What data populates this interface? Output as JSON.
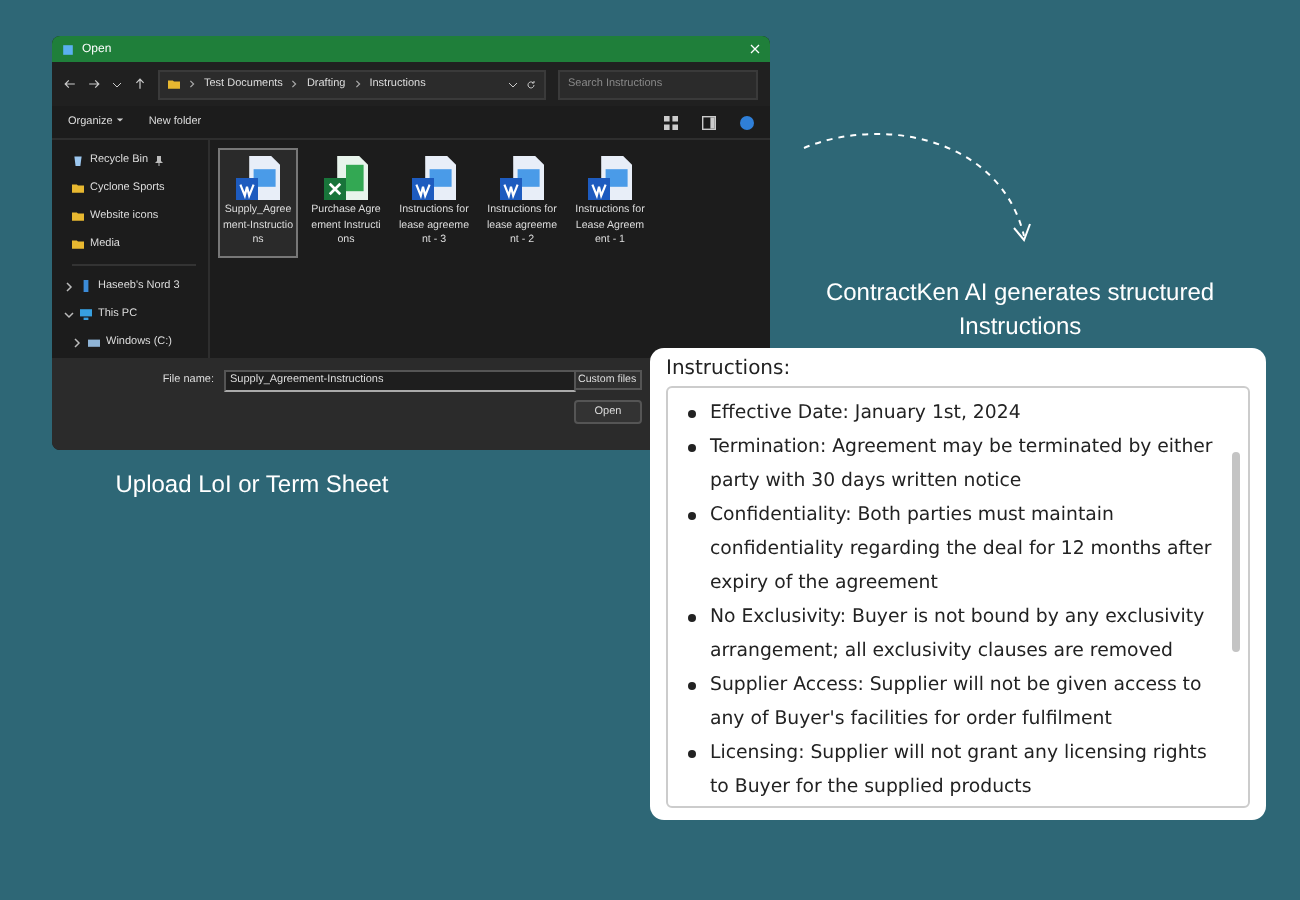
{
  "dialog": {
    "title": "Open",
    "breadcrumb": [
      "Test Documents",
      "Drafting",
      "Instructions"
    ],
    "search": {
      "placeholder": "Search Instructions"
    },
    "toolbar": [
      {
        "label": "Organize",
        "dropdown": true
      },
      {
        "label": "New folder",
        "dropdown": false
      }
    ],
    "sidebar": {
      "items": [
        {
          "label": "Recycle Bin",
          "kind": "bin",
          "pinned": true
        },
        {
          "label": "Cyclone Sports",
          "kind": "folder",
          "pinned": false
        },
        {
          "label": "Website icons",
          "kind": "folder",
          "pinned": false
        },
        {
          "label": "Media",
          "kind": "folder",
          "pinned": false
        },
        {
          "label": "Haseeb's Nord 3",
          "kind": "phone",
          "expanded": false
        },
        {
          "label": "This PC",
          "kind": "pc",
          "expanded": true,
          "children": [
            {
              "label": "Windows (C:)",
              "kind": "drive",
              "expanded": false
            }
          ]
        }
      ]
    },
    "files": [
      {
        "name": "Supply_Agreement-Instructions",
        "kind": "word",
        "selected": true
      },
      {
        "name": "Purchase Agreement Instructions",
        "kind": "excel",
        "selected": false
      },
      {
        "name": "Instructions for lease agreement - 3",
        "kind": "word",
        "selected": false
      },
      {
        "name": "Instructions for lease agreement - 2",
        "kind": "word",
        "selected": false
      },
      {
        "name": "Instructions for Lease Agreement - 1",
        "kind": "word",
        "selected": false
      }
    ],
    "file_name_label": "File name:",
    "file_name_value": "Supply_Agreement-Instructions",
    "file_type": "Custom files",
    "open_button": "Open"
  },
  "upload_caption": "Upload LoI or Term Sheet",
  "ai_caption": "ContractKen AI generates structured Instructions",
  "instructions": {
    "title": "Instructions:",
    "items": [
      "Effective Date: January 1st, 2024",
      "Termination: Agreement may be terminated by either party with 30 days written notice",
      "Confidentiality: Both parties must maintain confidentiality regarding the deal for 12 months after expiry of the agreement",
      "No Exclusivity: Buyer is not bound by any exclusivity arrangement; all exclusivity clauses are removed",
      "Supplier Access: Supplier will not be given access to any of Buyer's facilities for order fulfilment",
      "Licensing: Supplier will not grant any licensing rights to Buyer for the supplied products"
    ]
  }
}
